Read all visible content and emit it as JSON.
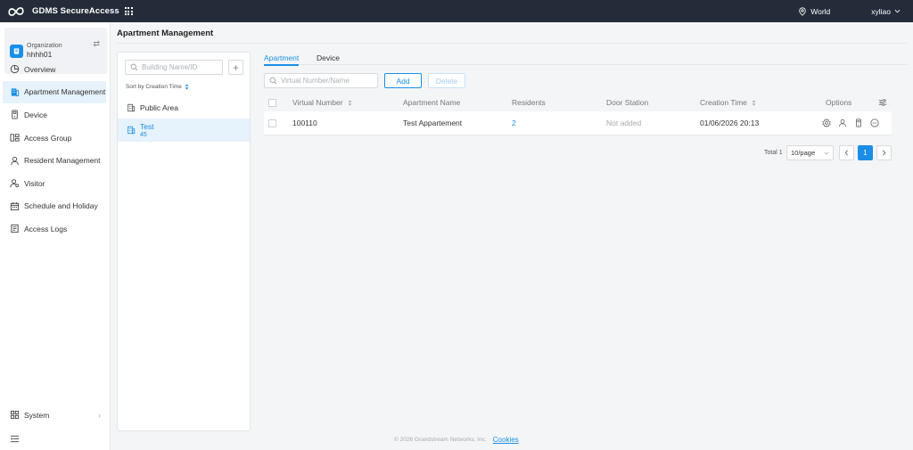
{
  "topbar": {
    "app_title": "GDMS SecureAccess",
    "region": "World",
    "username": "xyliao"
  },
  "org": {
    "label": "Organization",
    "name": "hhhh01"
  },
  "sidebar": {
    "items": [
      {
        "label": "Overview",
        "icon": "pie-chart-icon"
      },
      {
        "label": "Apartment Management",
        "icon": "building-icon",
        "active": true
      },
      {
        "label": "Device",
        "icon": "device-icon"
      },
      {
        "label": "Access Group",
        "icon": "access-group-icon"
      },
      {
        "label": "Resident Management",
        "icon": "user-icon"
      },
      {
        "label": "Visitor",
        "icon": "visitor-icon"
      },
      {
        "label": "Schedule and Holiday",
        "icon": "calendar-icon"
      },
      {
        "label": "Access Logs",
        "icon": "logs-icon"
      }
    ],
    "system_label": "System"
  },
  "page": {
    "title": "Apartment Management"
  },
  "buildings": {
    "search_placeholder": "Building Name/ID",
    "sort_label": "Sort by Creation Time",
    "items": [
      {
        "name": "Public Area",
        "count": ""
      },
      {
        "name": "Test",
        "count": "45"
      }
    ]
  },
  "tabs": [
    {
      "label": "Apartment",
      "active": true
    },
    {
      "label": "Device",
      "active": false
    }
  ],
  "toolbar": {
    "search_placeholder": "Virtual Number/Name",
    "add_label": "Add",
    "delete_label": "Delete"
  },
  "table": {
    "columns": [
      "Virtual Number",
      "Apartment Name",
      "Residents",
      "Door Station",
      "Creation Time",
      "Options"
    ],
    "rows": [
      {
        "virtual_number": "100110",
        "apartment_name": "Test Appartement",
        "residents": "2",
        "door_station": "Not added",
        "creation_time": "01/06/2026 20:13"
      }
    ]
  },
  "pagination": {
    "total": "Total 1",
    "page_size": "10/page",
    "current_page": "1"
  },
  "footer": {
    "copyright": "© 2026 Grandstream Networks, Inc.",
    "cookies": "Cookies"
  },
  "colors": {
    "accent": "#1a8ee6",
    "topbar": "#242c3a"
  }
}
